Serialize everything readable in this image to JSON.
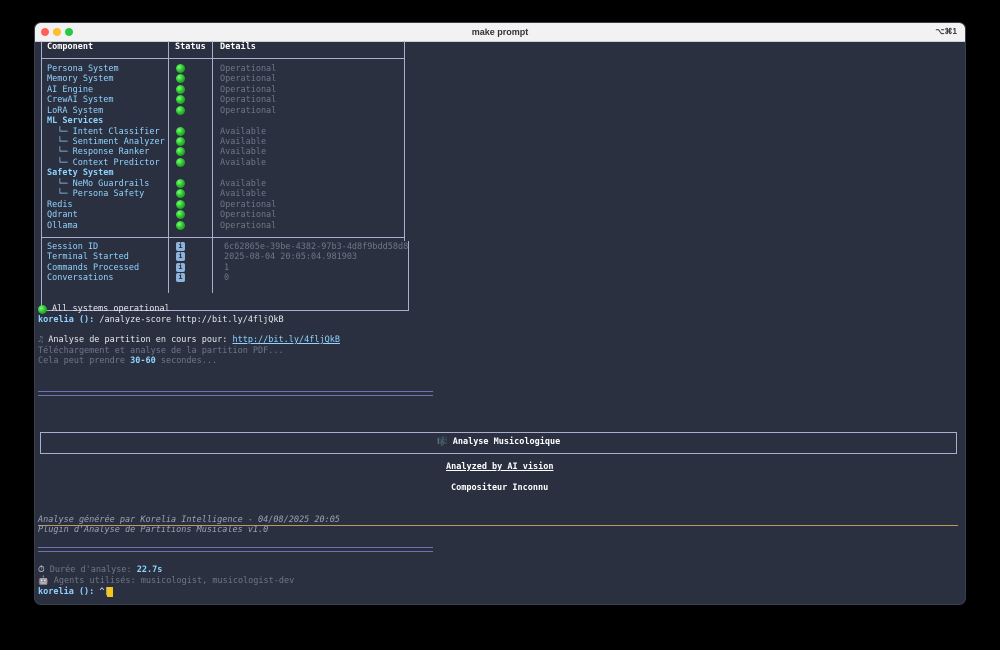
{
  "window": {
    "title": "make prompt",
    "shortcut": "⌥⌘1"
  },
  "status_table": {
    "headers": {
      "component": "Component",
      "status": "Status",
      "details": "Details"
    },
    "rows": [
      {
        "label": "Persona System",
        "detail": "Operational"
      },
      {
        "label": "Memory System",
        "detail": "Operational"
      },
      {
        "label": "AI Engine",
        "detail": "Operational"
      },
      {
        "label": "CrewAI System",
        "detail": "Operational"
      },
      {
        "label": "LoRA System",
        "detail": "Operational"
      },
      {
        "label": "ML Services",
        "detail": ""
      },
      {
        "label": "  └─ Intent Classifier",
        "detail": "Available"
      },
      {
        "label": "  └─ Sentiment Analyzer",
        "detail": "Available"
      },
      {
        "label": "  └─ Response Ranker",
        "detail": "Available"
      },
      {
        "label": "  └─ Context Predictor",
        "detail": "Available"
      },
      {
        "label": "Safety System",
        "detail": ""
      },
      {
        "label": "  └─ NeMo Guardrails",
        "detail": "Available"
      },
      {
        "label": "  └─ Persona Safety",
        "detail": "Available"
      },
      {
        "label": "Redis",
        "detail": "Operational"
      },
      {
        "label": "Qdrant",
        "detail": "Operational"
      },
      {
        "label": "Ollama",
        "detail": "Operational"
      }
    ],
    "session_rows": [
      {
        "label": "Session ID",
        "detail": "6c62865e-39be-4382-97b3-4d8f9bdd58d8"
      },
      {
        "label": "Terminal Started",
        "detail": "2025-08-04 20:05:04.981903"
      },
      {
        "label": "Commands Processed",
        "detail": "1"
      },
      {
        "label": "Conversations",
        "detail": "0"
      }
    ]
  },
  "output": {
    "all_ok": "All systems operational",
    "prompt1": "korelia ():",
    "cmd1": " /analyze-score http://bit.ly/4fljQkB",
    "analysis_prefix": "Analyse de partition en cours pour: ",
    "analysis_url": "http://bit.ly/4fljQkB",
    "downloading": "Téléchargement et analyse de la partition PDF...",
    "may_take_a": "Cela peut prendre ",
    "may_take_b": "30-60",
    "may_take_c": " secondes...",
    "separator": "================================================================================",
    "panel_icon": "🎼",
    "panel_title": "Analyse Musicologique",
    "analyzed_by": "Analyzed by AI vision",
    "composer": "Compositeur Inconnu",
    "generated_by": "Analyse générée par Korelia Intelligence - 04/08/2025 20:05",
    "plugin": "Plugin d'Analyse de Partitions Musicales v1.0",
    "duration_icon": "⏱",
    "duration_label": " Durée d'analyse: ",
    "duration_value": "22.7s",
    "agents_icon": "🤖",
    "agents_label": " Agents utilisés: musicologist, musicologist-dev",
    "prompt2": "korelia ():",
    "input_value": " ^["
  }
}
